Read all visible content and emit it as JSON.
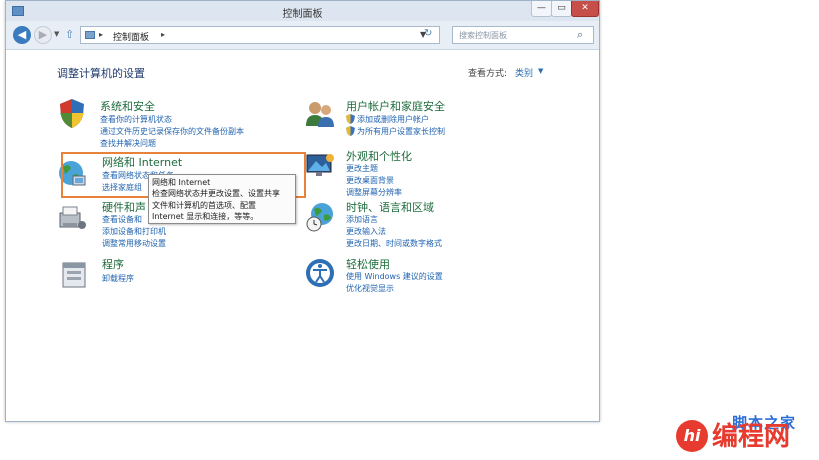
{
  "window": {
    "title": "控制面板",
    "min_glyph": "—",
    "max_glyph": "▭",
    "close_glyph": "✕"
  },
  "nav": {
    "back_glyph": "◀",
    "forward_glyph": "▶",
    "dropdown_glyph": "▼",
    "up_glyph": "⇧"
  },
  "address": {
    "separator": "▸",
    "path": "控制面板",
    "dropdown_glyph": "▼",
    "refresh_glyph": "↻"
  },
  "search": {
    "placeholder": "搜索控制面板",
    "icon_glyph": "⌕"
  },
  "heading": "调整计算机的设置",
  "view": {
    "label": "查看方式:",
    "value": "类别",
    "dropdown_glyph": "▼"
  },
  "categories": {
    "system": {
      "title": "系统和安全",
      "links": [
        "查看你的计算机状态",
        "通过文件历史记录保存你的文件备份副本",
        "查找并解决问题"
      ]
    },
    "network": {
      "title": "网络和 Internet",
      "links": [
        "查看网络状态和任务",
        "选择家庭组"
      ]
    },
    "hardware": {
      "title": "硬件和声",
      "links": [
        "查看设备和",
        "添加设备和打印机",
        "调整常用移动设置"
      ]
    },
    "programs": {
      "title": "程序",
      "links": [
        "卸载程序"
      ]
    },
    "accounts": {
      "title": "用户帐户和家庭安全",
      "links": [
        "添加或删除用户帐户",
        "为所有用户设置家长控制"
      ]
    },
    "appearance": {
      "title": "外观和个性化",
      "links": [
        "更改主题",
        "更改桌面背景",
        "调整屏幕分辨率"
      ]
    },
    "clock": {
      "title": "时钟、语言和区域",
      "links": [
        "添加语言",
        "更改输入法",
        "更改日期、时间或数字格式"
      ]
    },
    "ease": {
      "title": "轻松使用",
      "links": [
        "使用 Windows 建议的设置",
        "优化视觉显示"
      ]
    }
  },
  "tooltip": {
    "lines": [
      "网络和 Internet",
      "检查网络状态并更改设置、设置共享",
      "文件和计算机的首选项、配置",
      "Internet 显示和连接，等等。"
    ]
  },
  "watermark": {
    "text": "编程网",
    "upper_text": "脚本之家",
    "logo_letters": "hi"
  },
  "colors": {
    "accent": "#1f63b0",
    "category_title": "#1e6b3c",
    "highlight_box": "#e8823a",
    "watermark": "#e63b2e"
  }
}
